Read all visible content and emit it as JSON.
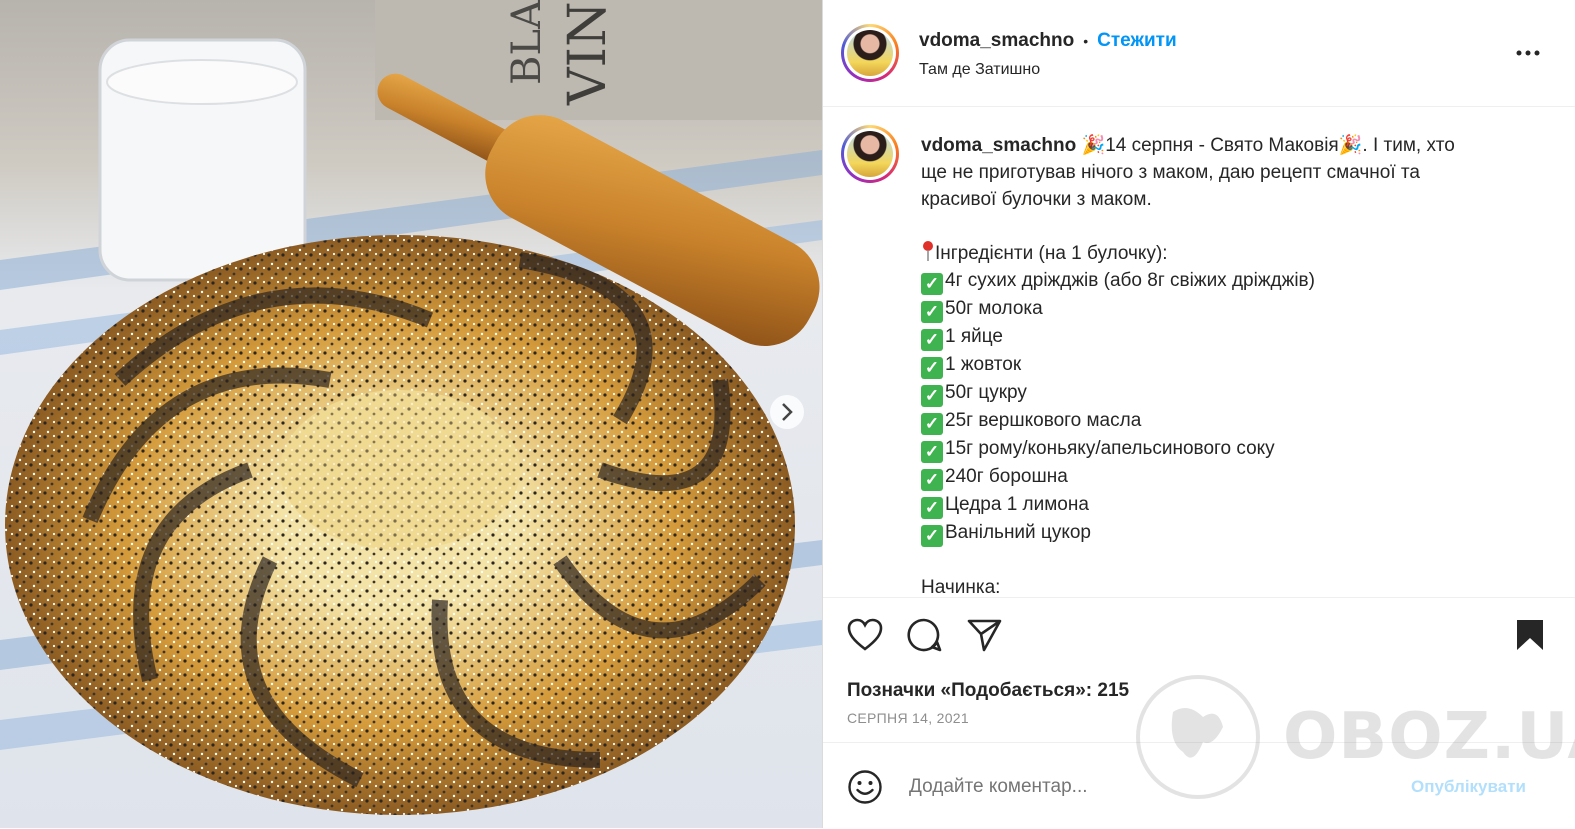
{
  "header": {
    "username": "vdoma_smachno",
    "separator": "•",
    "follow_label": "Стежити",
    "location": "Там де Затишно",
    "more_icon": "more-horizontal-icon"
  },
  "post": {
    "username": "vdoma_smachno",
    "intro_line1": "14 серпня - Свято Маковія",
    "intro_line1_rest": ". І тим, хто",
    "intro_line2": "ще не приготував нічого з маком, даю рецепт смачної та",
    "intro_line3": "красивої булочки з маком.",
    "ingredients_title": "Інгредієнти (на 1 булочку):",
    "ingredients": [
      "4г сухих дріжджів (або 8г свіжих дріжджів)",
      "50г молока",
      "1 яйце",
      "1 жовток",
      "50г цукру",
      "25г вершкового масла",
      "15г рому/коньяку/апельсинового соку",
      "240г борошна",
      "Цедра 1 лимона",
      "Ванільний цукор"
    ],
    "filling_title": "Начинка:"
  },
  "actions": {
    "like_icon": "heart-icon",
    "comment_icon": "comment-icon",
    "share_icon": "send-icon",
    "save_icon": "bookmark-icon"
  },
  "likes_label": "Позначки «Подобається»: 215",
  "date": "СЕРПНЯ 14, 2021",
  "comment": {
    "placeholder": "Додайте коментар...",
    "publish_label": "Опублікувати"
  },
  "watermark": "OBOZ.UA",
  "photo": {
    "sign_text_1": "BLANC",
    "sign_text_2": "VIN",
    "next_icon": "chevron-right-icon"
  }
}
